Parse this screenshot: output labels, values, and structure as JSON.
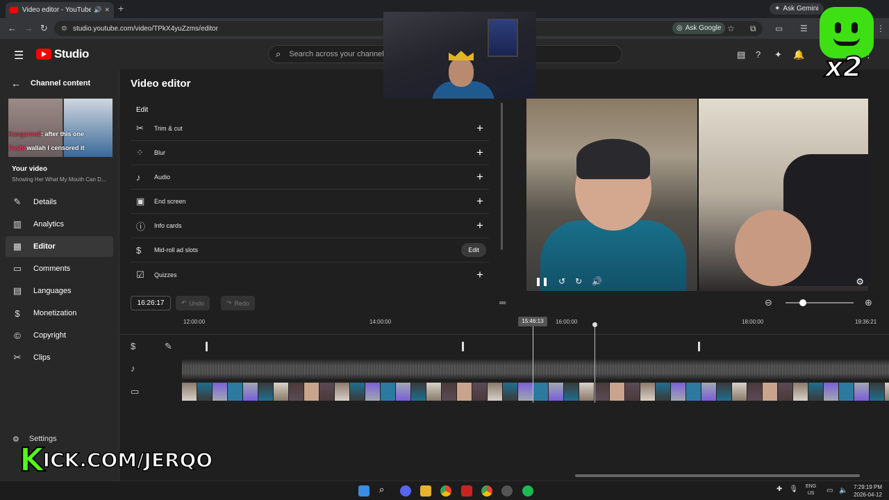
{
  "browser": {
    "tab_title": "Video editor - YouTube Stu",
    "new_tab": "+",
    "ask_gemini": "Ask Gemini",
    "url": "studio.youtube.com/video/TPkX4yuZzms/editor",
    "ask_google": "Ask Google"
  },
  "header": {
    "logo_text": "Studio",
    "search_placeholder": "Search across your channel"
  },
  "sidebar": {
    "back_label": "Channel content",
    "thumb_chat": [
      {
        "user": "Kangaroo2",
        "msg": ": after this one"
      },
      {
        "user": "Fushi",
        "msg": "wallah I censored it"
      }
    ],
    "your_video_label": "Your video",
    "video_title": "Showing Her What My Mouth Can D...",
    "items": [
      {
        "label": "Details",
        "icon": "pencil-icon"
      },
      {
        "label": "Analytics",
        "icon": "analytics-icon"
      },
      {
        "label": "Editor",
        "icon": "editor-icon"
      },
      {
        "label": "Comments",
        "icon": "comments-icon"
      },
      {
        "label": "Languages",
        "icon": "languages-icon"
      },
      {
        "label": "Monetization",
        "icon": "dollar-icon"
      },
      {
        "label": "Copyright",
        "icon": "copyright-icon"
      },
      {
        "label": "Clips",
        "icon": "scissors-icon"
      }
    ],
    "settings_label": "Settings"
  },
  "main": {
    "title": "Video editor",
    "edit_heading": "Edit",
    "edit_rows": [
      {
        "label": "Trim & cut",
        "icon": "scissors-icon",
        "action": "+"
      },
      {
        "label": "Blur",
        "icon": "blur-icon",
        "action": "+"
      },
      {
        "label": "Audio",
        "icon": "music-note-icon",
        "action": "+"
      },
      {
        "label": "End screen",
        "icon": "end-screen-icon",
        "action": "+"
      },
      {
        "label": "Info cards",
        "icon": "info-icon",
        "action": "+"
      },
      {
        "label": "Mid-roll ad slots",
        "icon": "dollar-icon",
        "action": "Edit"
      },
      {
        "label": "Quizzes",
        "icon": "checkbox-icon",
        "action": "+"
      }
    ]
  },
  "timeline": {
    "timecode": "16:26:17",
    "undo_label": "Undo",
    "redo_label": "Redo",
    "ruler_labels": [
      "12:00:00",
      "14:00:00",
      "16:00:00",
      "18:00:00",
      "19:36:21"
    ],
    "playhead_time": "15:46:13",
    "zoom_level": 0.25
  },
  "watermark": {
    "kick_letter": "K",
    "kick_url": "ICK.COM/JERQO",
    "multiplier": "x2"
  },
  "taskbar": {
    "lang_line1": "ENG",
    "lang_line2": "US",
    "time": "7:29:19 PM",
    "date": "2026-04-12"
  }
}
